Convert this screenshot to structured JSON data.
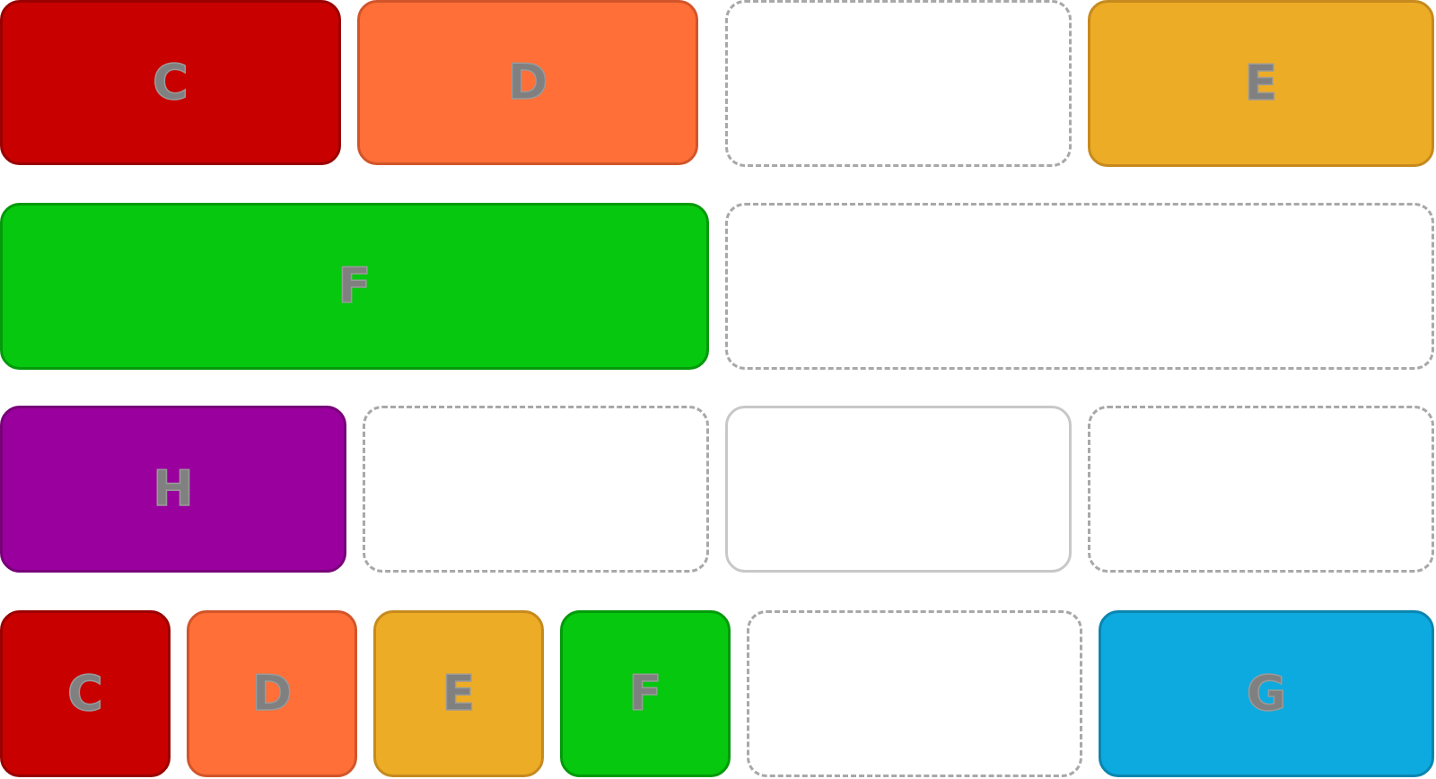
{
  "colors": {
    "C": {
      "fill": "#c80000",
      "edge": "#9a0000"
    },
    "D": {
      "fill": "#ff6f37",
      "edge": "#d2552a"
    },
    "E": {
      "fill": "#edac26",
      "edge": "#c68a1e"
    },
    "F": {
      "fill": "#06c80f",
      "edge": "#049a0b"
    },
    "G": {
      "fill": "#0daadf",
      "edge": "#0a86b0"
    },
    "H": {
      "fill": "#9a009e",
      "edge": "#780079"
    },
    "letter": "#808080",
    "slot_border": "#a8a8a8",
    "slot_solid_border": "#c8c8c8"
  },
  "rows": [
    {
      "tiles": [
        {
          "id": "t-r1-c1",
          "kind": "filled",
          "letter": "C"
        },
        {
          "id": "t-r1-c2",
          "kind": "filled",
          "letter": "D"
        },
        {
          "id": "t-r1-c3",
          "kind": "slot",
          "letter": ""
        },
        {
          "id": "t-r1-c4",
          "kind": "filled",
          "letter": "E"
        }
      ]
    },
    {
      "tiles": [
        {
          "id": "t-r2-c1",
          "kind": "filled",
          "letter": "F"
        },
        {
          "id": "t-r2-c2",
          "kind": "slot",
          "letter": ""
        }
      ]
    },
    {
      "tiles": [
        {
          "id": "t-r3-c1",
          "kind": "filled",
          "letter": "H"
        },
        {
          "id": "t-r3-c2",
          "kind": "slot",
          "letter": ""
        },
        {
          "id": "t-r3-c3",
          "kind": "slot-solid",
          "letter": ""
        },
        {
          "id": "t-r3-c4",
          "kind": "slot",
          "letter": ""
        }
      ]
    },
    {
      "tiles": [
        {
          "id": "t-r4-c1",
          "kind": "filled",
          "letter": "C"
        },
        {
          "id": "t-r4-c2",
          "kind": "filled",
          "letter": "D"
        },
        {
          "id": "t-r4-c3",
          "kind": "filled",
          "letter": "E"
        },
        {
          "id": "t-r4-c4",
          "kind": "filled",
          "letter": "F"
        },
        {
          "id": "t-r4-c5",
          "kind": "slot",
          "letter": ""
        },
        {
          "id": "t-r4-c6",
          "kind": "filled",
          "letter": "G"
        }
      ]
    }
  ]
}
